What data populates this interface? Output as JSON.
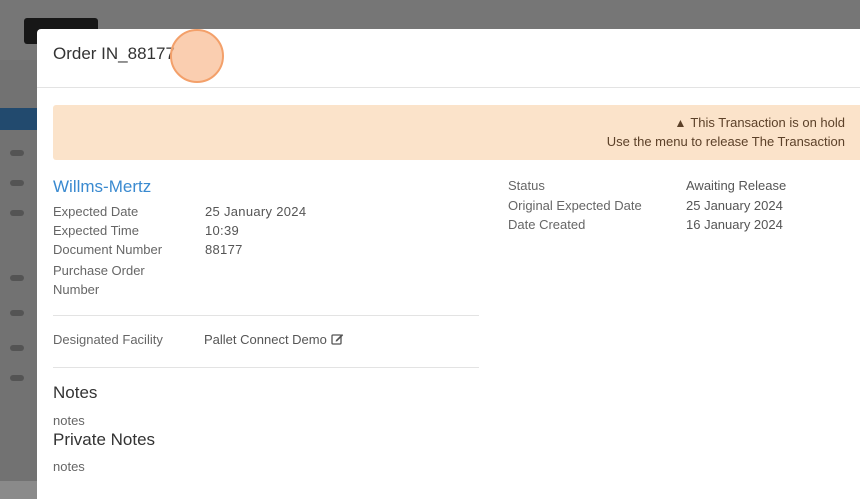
{
  "modal": {
    "title": "Order IN_88177"
  },
  "alert": {
    "line1": "This Transaction is on hold",
    "line2": "Use the menu to release The Transaction",
    "icon": "warning-icon"
  },
  "order": {
    "company": "Willms-Mertz",
    "left_fields": [
      {
        "label": "Expected Date",
        "value": "25 January 2024"
      },
      {
        "label": "Expected Time",
        "value": "10:39"
      },
      {
        "label": "Document Number",
        "value": "88177"
      },
      {
        "label": "Purchase Order Number",
        "value": ""
      }
    ],
    "right_fields": [
      {
        "label": "Status",
        "value": "Awaiting Release"
      },
      {
        "label": "Original Expected Date",
        "value": "25 January 2024"
      },
      {
        "label": "Date Created",
        "value": "16 January 2024"
      }
    ]
  },
  "facility": {
    "label": "Designated Facility",
    "value": "Pallet Connect Demo",
    "icon": "edit-icon"
  },
  "notes": {
    "heading": "Notes",
    "text": "notes"
  },
  "private_notes": {
    "heading": "Private Notes",
    "text": "notes"
  }
}
